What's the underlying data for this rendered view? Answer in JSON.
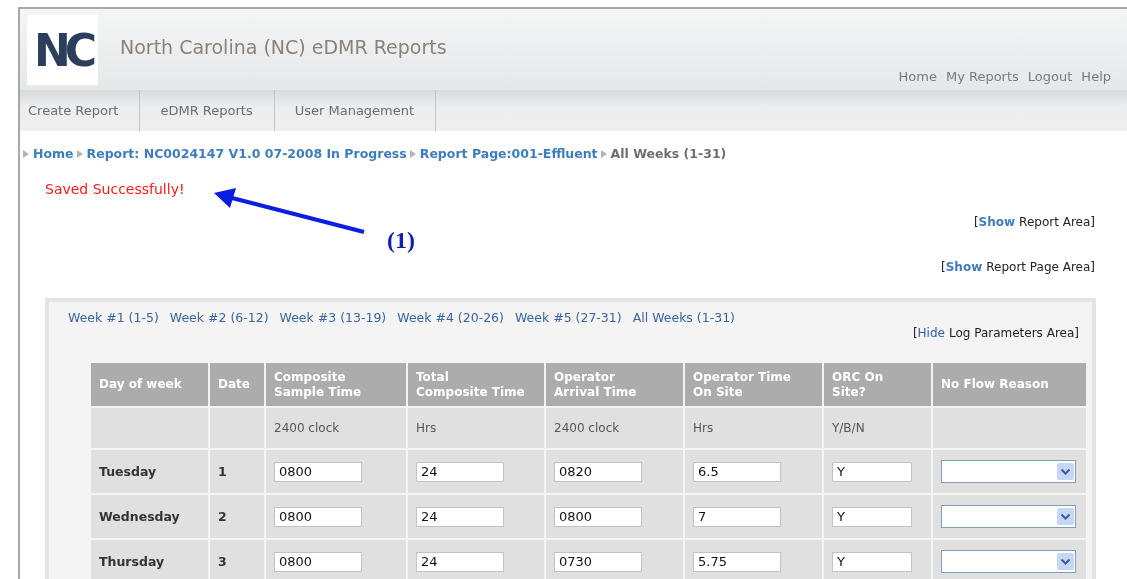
{
  "header": {
    "logo_text": "NC",
    "title": "North Carolina (NC) eDMR Reports",
    "links": [
      "Home",
      "My Reports",
      "Logout",
      "Help"
    ]
  },
  "nav": [
    {
      "label": "Create Report",
      "selected": false
    },
    {
      "label": "eDMR Reports",
      "selected": false
    },
    {
      "label": "User Management",
      "selected": false
    }
  ],
  "breadcrumb": [
    {
      "label": "Home",
      "link": true
    },
    {
      "label": "Report: NC0024147 V1.0 07-2008 In Progress",
      "link": true
    },
    {
      "label": "Report Page:001-Effluent",
      "link": true
    },
    {
      "label": "All Weeks (1-31)",
      "link": false
    }
  ],
  "message": "Saved Successfully!",
  "annotation": {
    "label": "(1)"
  },
  "toggles": [
    {
      "open": "[",
      "link": "Show",
      "label": "Report Area",
      "close": "]"
    },
    {
      "open": "[",
      "link": "Show",
      "label": "Report Page Area",
      "close": "]"
    }
  ],
  "log_panel": {
    "weeks": [
      "Week #1 (1-5)",
      "Week #2 (6-12)",
      "Week #3 (13-19)",
      "Week #4 (20-26)",
      "Week #5 (27-31)",
      "All Weeks (1-31)"
    ],
    "toggle": {
      "open": "[",
      "link": "Hide",
      "label": "Log Parameters Area",
      "close": "]"
    },
    "columns": [
      "Day of week",
      "Date",
      "Composite\nSample Time",
      "Total\nComposite Time",
      "Operator\nArrival Time",
      "Operator Time\nOn Site",
      "ORC On\nSite?",
      "No Flow Reason"
    ],
    "units": [
      "2400 clock",
      "Hrs",
      "2400 clock",
      "Hrs",
      "Y/B/N"
    ],
    "rows": [
      {
        "day": "Tuesday",
        "date": "1",
        "values": [
          "0800",
          "24",
          "0820",
          "6.5",
          "Y"
        ]
      },
      {
        "day": "Wednesday",
        "date": "2",
        "values": [
          "0800",
          "24",
          "0800",
          "7",
          "Y"
        ]
      },
      {
        "day": "Thursday",
        "date": "3",
        "values": [
          "0800",
          "24",
          "0730",
          "5.75",
          "Y"
        ]
      }
    ]
  }
}
